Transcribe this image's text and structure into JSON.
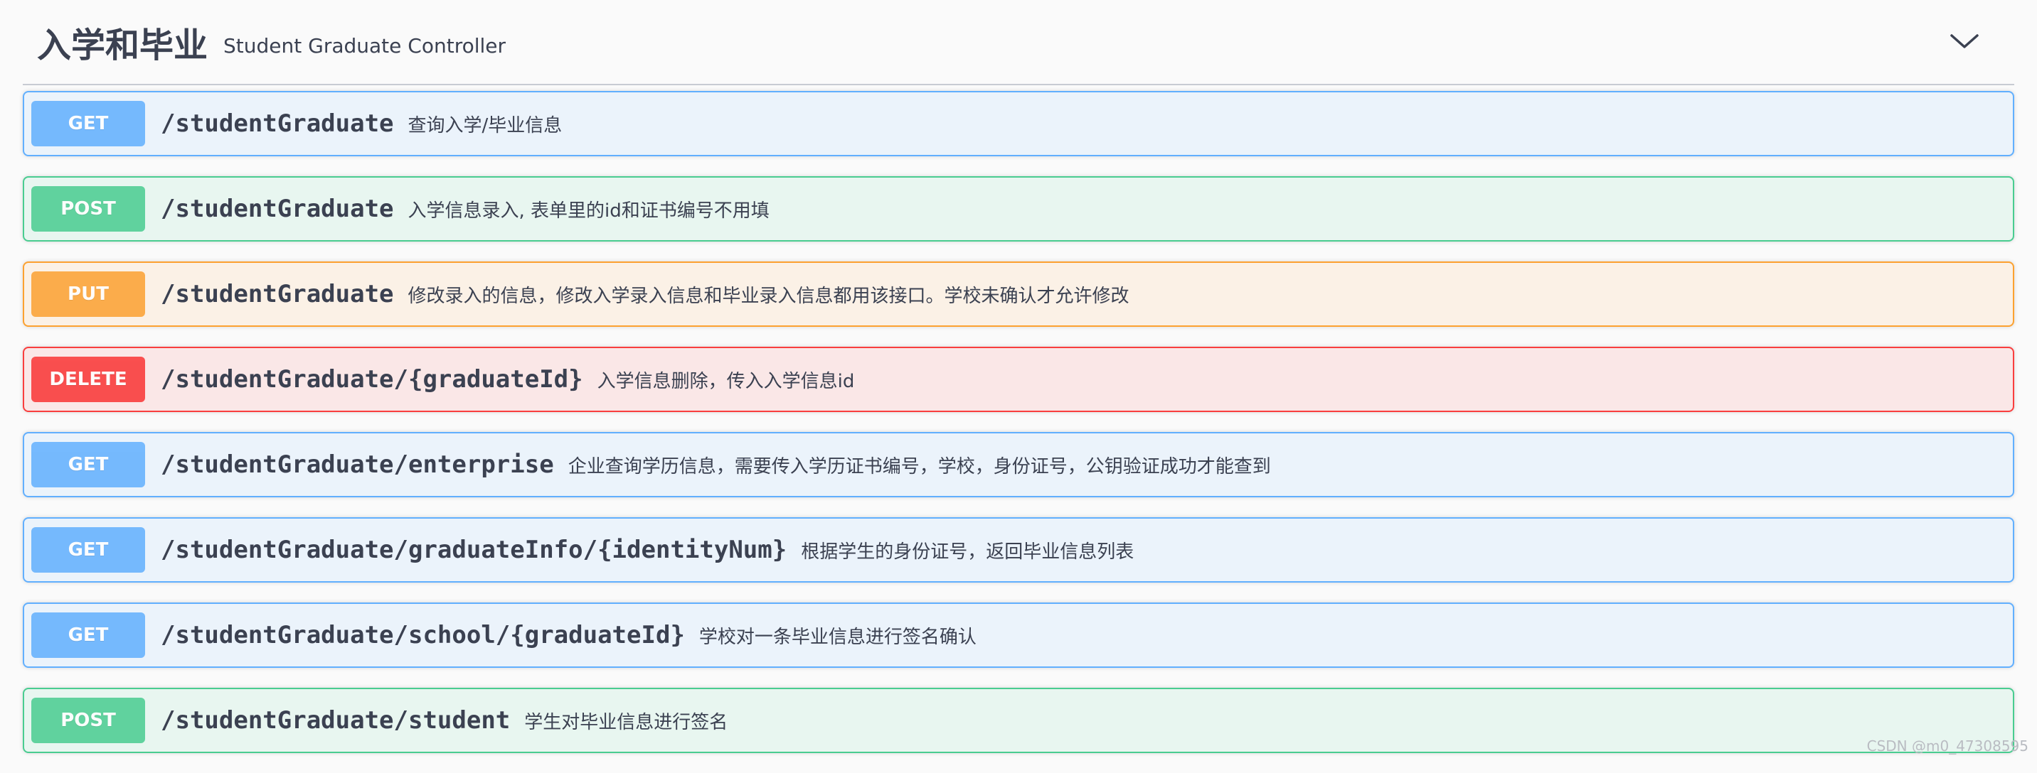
{
  "section": {
    "title": "入学和毕业",
    "subtitle": "Student Graduate Controller",
    "collapse_icon": "chevron-down-icon"
  },
  "colors": {
    "get": "#61affe",
    "post": "#49cc90",
    "put": "#fca130",
    "delete": "#f93e3e"
  },
  "operations": [
    {
      "method": "GET",
      "path": "/studentGraduate",
      "description": "查询入学/毕业信息"
    },
    {
      "method": "POST",
      "path": "/studentGraduate",
      "description": "入学信息录入, 表单里的id和证书编号不用填"
    },
    {
      "method": "PUT",
      "path": "/studentGraduate",
      "description": "修改录入的信息，修改入学录入信息和毕业录入信息都用该接口。学校未确认才允许修改"
    },
    {
      "method": "DELETE",
      "path": "/studentGraduate/{graduateId}",
      "description": "入学信息删除，传入入学信息id"
    },
    {
      "method": "GET",
      "path": "/studentGraduate/enterprise",
      "description": "企业查询学历信息，需要传入学历证书编号，学校，身份证号，公钥验证成功才能查到"
    },
    {
      "method": "GET",
      "path": "/studentGraduate/graduateInfo/{identityNum}",
      "description": "根据学生的身份证号，返回毕业信息列表"
    },
    {
      "method": "GET",
      "path": "/studentGraduate/school/{graduateId}",
      "description": "学校对一条毕业信息进行签名确认"
    },
    {
      "method": "POST",
      "path": "/studentGraduate/student",
      "description": "学生对毕业信息进行签名"
    }
  ],
  "watermark": "CSDN @m0_47308595"
}
